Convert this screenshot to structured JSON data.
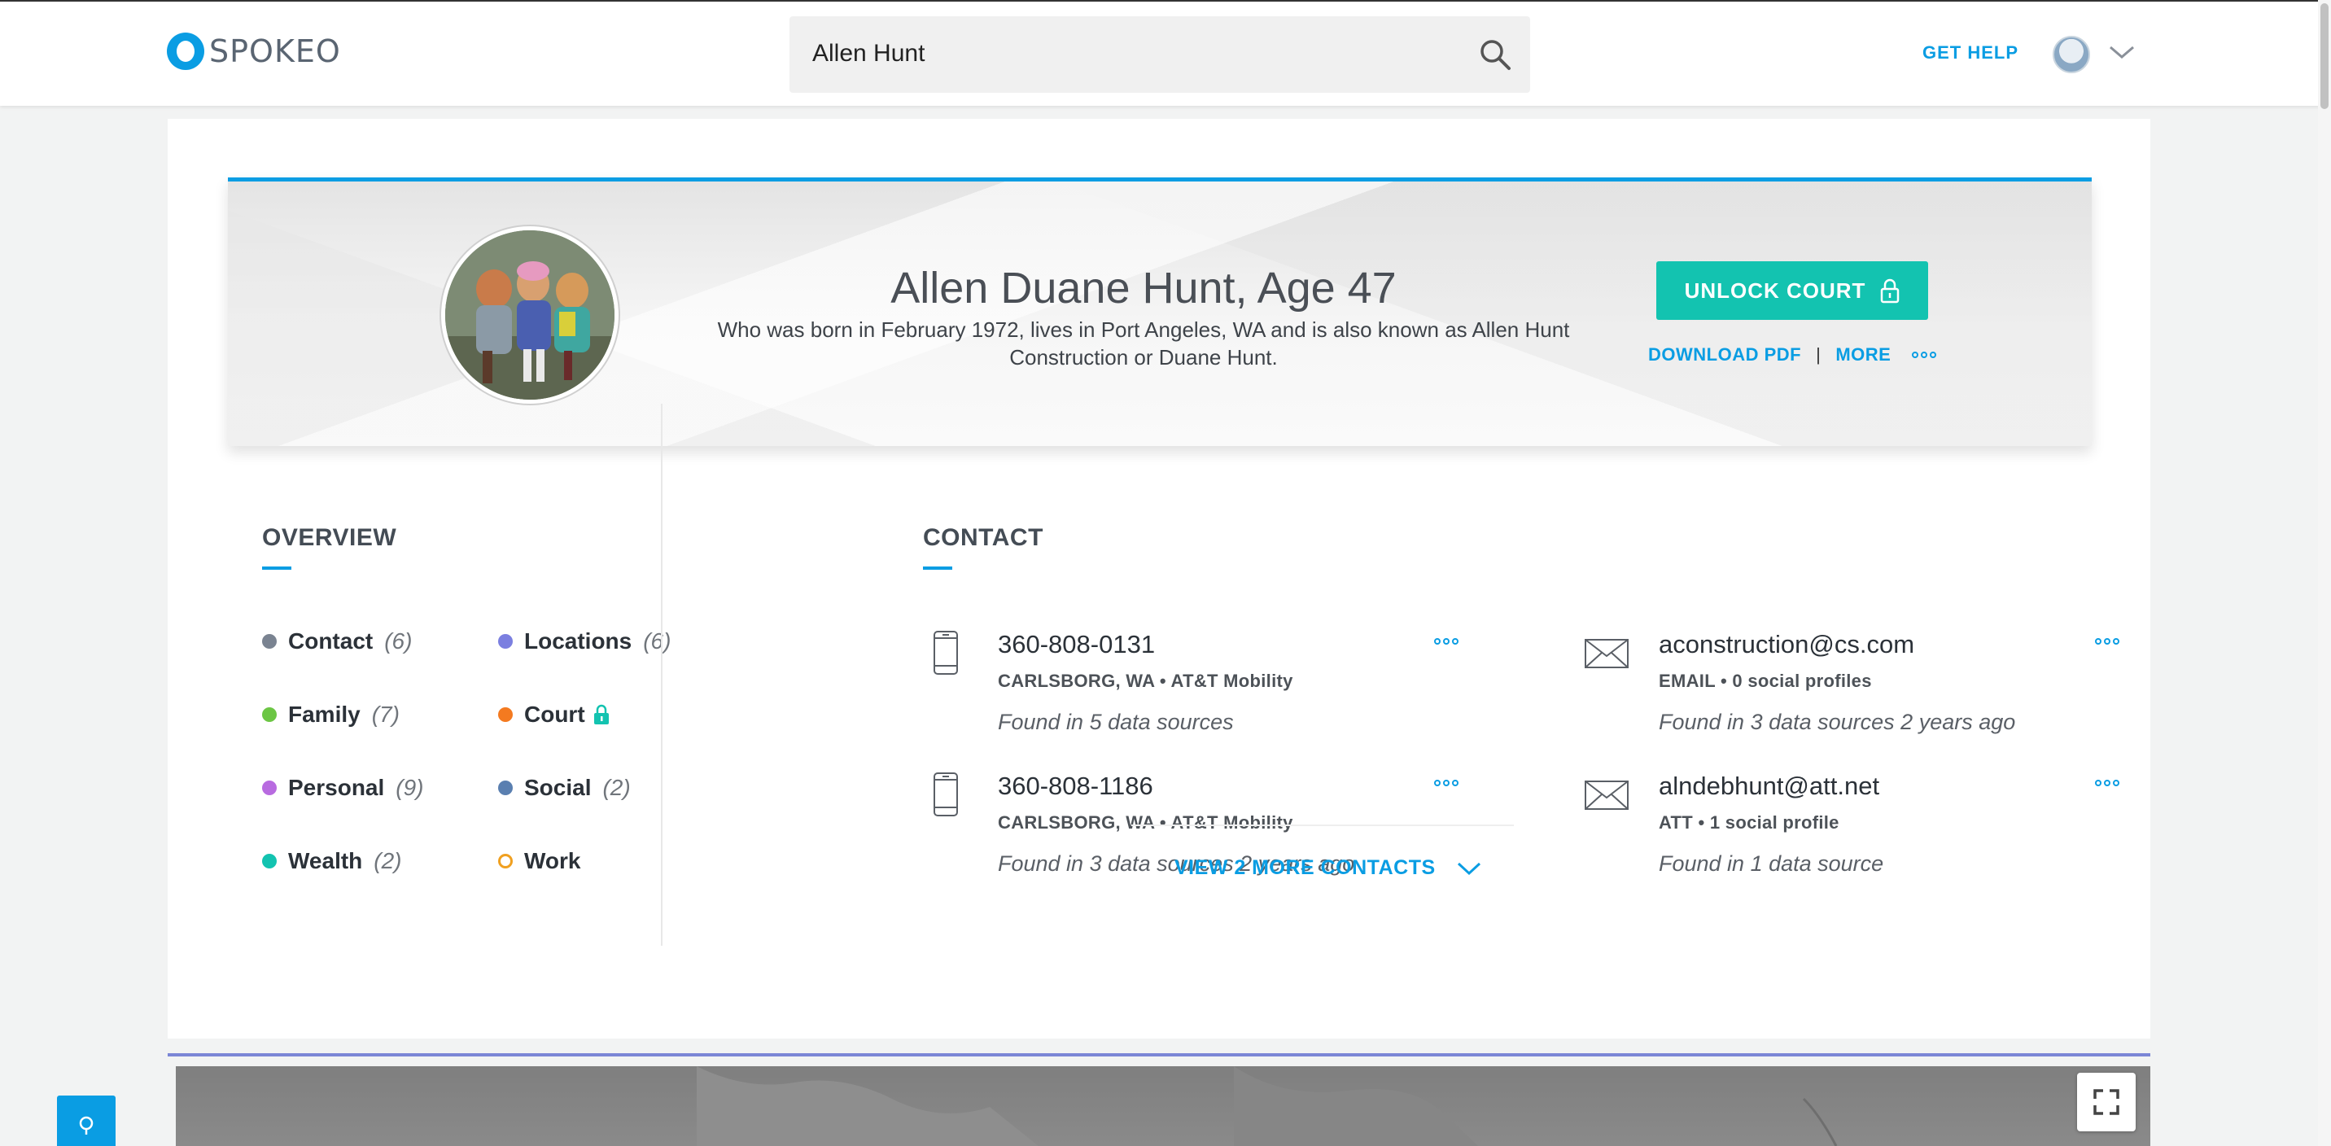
{
  "header": {
    "logo_text": "SPOKEO",
    "search_value": "Allen Hunt",
    "get_help": "GET HELP"
  },
  "profile": {
    "name_age": "Allen Duane Hunt, Age 47",
    "description": "Who was born in February 1972, lives in Port Angeles, WA and is also known as Allen Hunt Construction or Duane Hunt.",
    "unlock_label": "UNLOCK COURT",
    "download_pdf": "DOWNLOAD PDF",
    "separator": "|",
    "more": "MORE"
  },
  "overview": {
    "title": "OVERVIEW",
    "items": [
      {
        "label": "Contact",
        "count": "(6)",
        "color": "#7a8391"
      },
      {
        "label": "Locations",
        "count": "(6)",
        "color": "#7b7fe0"
      },
      {
        "label": "Family",
        "count": "(7)",
        "color": "#6cc644"
      },
      {
        "label": "Court",
        "count": "",
        "color": "#f47a20",
        "locked": true,
        "lock_color": "#13c3b0"
      },
      {
        "label": "Personal",
        "count": "(9)",
        "color": "#b86be0"
      },
      {
        "label": "Social",
        "count": "(2)",
        "color": "#5a7fb0"
      },
      {
        "label": "Wealth",
        "count": "(2)",
        "color": "#13c3b0"
      },
      {
        "label": "Work",
        "count": "",
        "color": "#f0a020",
        "hollow": true
      }
    ]
  },
  "contact": {
    "title": "CONTACT",
    "phones": [
      {
        "number": "360-808-0131",
        "carrier": "CARLSBORG, WA • AT&T Mobility",
        "found": "Found in 5 data sources"
      },
      {
        "number": "360-808-1186",
        "carrier": "CARLSBORG, WA • AT&T Mobility",
        "found": "Found in 3 data sources 2 years ago"
      }
    ],
    "emails": [
      {
        "address": "aconstruction@cs.com",
        "info": "EMAIL • 0 social profiles",
        "found": "Found in 3 data sources 2 years ago"
      },
      {
        "address": "alndebhunt@att.net",
        "info": "ATT • 1 social profile",
        "found": "Found in 1 data source"
      }
    ],
    "view_more": "VIEW 2 MORE CONTACTS"
  },
  "colors": {
    "brand": "#0a9de3",
    "unlock": "#13c3b0",
    "map_accent": "#7b86d6"
  }
}
